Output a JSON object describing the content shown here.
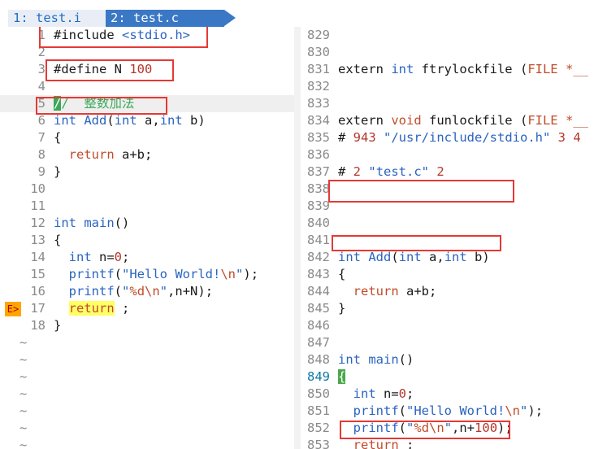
{
  "tabs": [
    {
      "label": "1: test.i",
      "active": false
    },
    {
      "label": "2: test.c",
      "active": true
    }
  ],
  "left_pane": {
    "file": "test.c",
    "lines": [
      {
        "n": "1",
        "text": "#include <stdio.h>"
      },
      {
        "n": "2",
        "text": ""
      },
      {
        "n": "3",
        "text": "#define N 100"
      },
      {
        "n": "4",
        "text": ""
      },
      {
        "n": "5",
        "text": "//  整数加法"
      },
      {
        "n": "6",
        "text": "int Add(int a,int b)"
      },
      {
        "n": "7",
        "text": "{"
      },
      {
        "n": "8",
        "text": "  return a+b;"
      },
      {
        "n": "9",
        "text": "}"
      },
      {
        "n": "10",
        "text": ""
      },
      {
        "n": "11",
        "text": ""
      },
      {
        "n": "12",
        "text": "int main()"
      },
      {
        "n": "13",
        "text": "{"
      },
      {
        "n": "14",
        "text": "  int n=0;"
      },
      {
        "n": "15",
        "text": "  printf(\"Hello World!\\n\");"
      },
      {
        "n": "16",
        "text": "  printf(\"%d\\n\",n+N);"
      },
      {
        "n": "17",
        "text": "  return ;"
      },
      {
        "n": "18",
        "text": "}"
      }
    ],
    "sign_label": "E>",
    "tilde": "~"
  },
  "right_pane": {
    "file": "test.i",
    "lines": [
      {
        "n": "829",
        "text": ""
      },
      {
        "n": "830",
        "text": ""
      },
      {
        "n": "831",
        "text": "extern int ftrylockfile (FILE *__"
      },
      {
        "n": "832",
        "text": ""
      },
      {
        "n": "833",
        "text": ""
      },
      {
        "n": "834",
        "text": "extern void funlockfile (FILE *__"
      },
      {
        "n": "835",
        "text": "# 943 \"/usr/include/stdio.h\" 3 4"
      },
      {
        "n": "836",
        "text": ""
      },
      {
        "n": "837",
        "text": "# 2 \"test.c\" 2"
      },
      {
        "n": "838",
        "text": ""
      },
      {
        "n": "839",
        "text": ""
      },
      {
        "n": "840",
        "text": ""
      },
      {
        "n": "841",
        "text": ""
      },
      {
        "n": "842",
        "text": "int Add(int a,int b)"
      },
      {
        "n": "843",
        "text": "{"
      },
      {
        "n": "844",
        "text": "  return a+b;"
      },
      {
        "n": "845",
        "text": "}"
      },
      {
        "n": "846",
        "text": ""
      },
      {
        "n": "847",
        "text": ""
      },
      {
        "n": "848",
        "text": "int main()"
      },
      {
        "n": "849",
        "text": "{"
      },
      {
        "n": "850",
        "text": "  int n=0;"
      },
      {
        "n": "851",
        "text": "  printf(\"Hello World!\\n\");"
      },
      {
        "n": "852",
        "text": "  printf(\"%d\\n\",n+100);"
      },
      {
        "n": "853",
        "text": "  return ;"
      }
    ]
  },
  "colors": {
    "keyword": "#c04c2a",
    "type": "#2a64c0",
    "string": "#2a64c0",
    "comment": "#3aa858",
    "line_number": "#8a8a8a",
    "annotation_box": "#e53935",
    "tab_active": "#3a78c6"
  }
}
